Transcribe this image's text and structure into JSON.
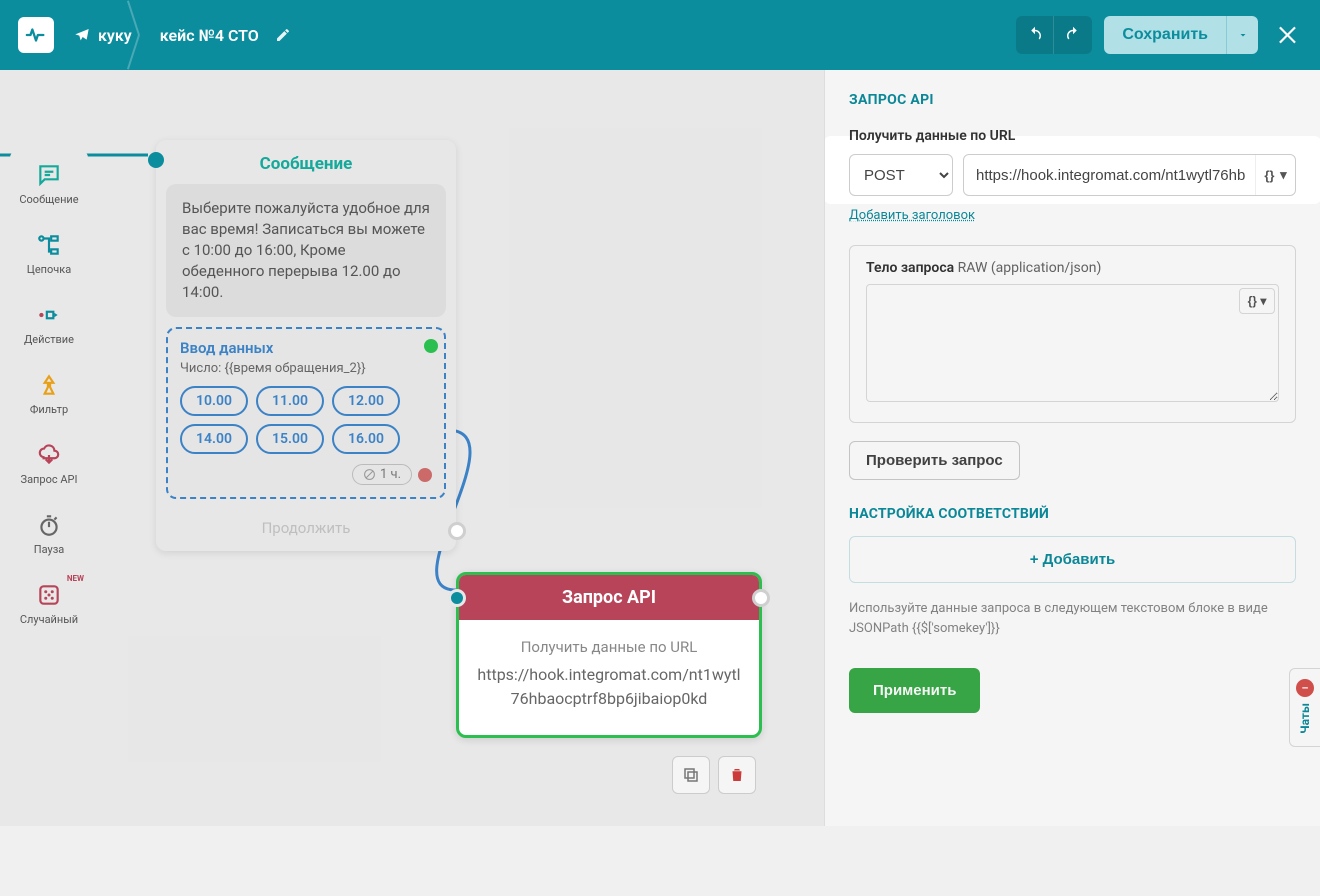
{
  "topbar": {
    "breadcrumb_parent": "куку",
    "breadcrumb_title": "кейс №4 СТО",
    "save_label": "Сохранить"
  },
  "sidebar": {
    "message": "Сообщение",
    "chain": "Цепочка",
    "action": "Действие",
    "filter": "Фильтр",
    "api": "Запрос API",
    "pause": "Пауза",
    "random": "Случайный",
    "new_badge": "NEW"
  },
  "node_message": {
    "title": "Сообщение",
    "body": "Выберите  пожалуйста удобное для вас время! Записаться вы можете с 10:00 до 16:00, Кроме обеденного перерыва 12.00 до 14:00.",
    "input_title": "Ввод данных",
    "input_sub": "Число: {{время обращения_2}}",
    "chips": [
      "10.00",
      "11.00",
      "12.00",
      "14.00",
      "15.00",
      "16.00"
    ],
    "timeout": "1 ч.",
    "continue": "Продолжить"
  },
  "node_api": {
    "title": "Запрос API",
    "subtitle": "Получить данные по URL",
    "url": "https://hook.integromat.com/nt1wytl76hbaocptrf8bp6jibaiop0kd"
  },
  "panel": {
    "heading": "ЗАПРОС API",
    "url_label": "Получить данные по URL",
    "method": "POST",
    "url_value": "https://hook.integromat.com/nt1wytl76hb",
    "add_header": "Добавить заголовок",
    "body_label_strong": "Тело запроса",
    "body_label_hint": "RAW (application/json)",
    "check_button": "Проверить запрос",
    "mapping_heading": "НАСТРОЙКА СООТВЕТСТВИЙ",
    "add_mapping": "+ Добавить",
    "hint": "Используйте данные запроса в следующем текстовом блоке в виде JSONPath {{$['somekey']}}",
    "apply": "Применить",
    "braces": "{}"
  },
  "chats": {
    "label": "Чаты",
    "count": "–"
  }
}
